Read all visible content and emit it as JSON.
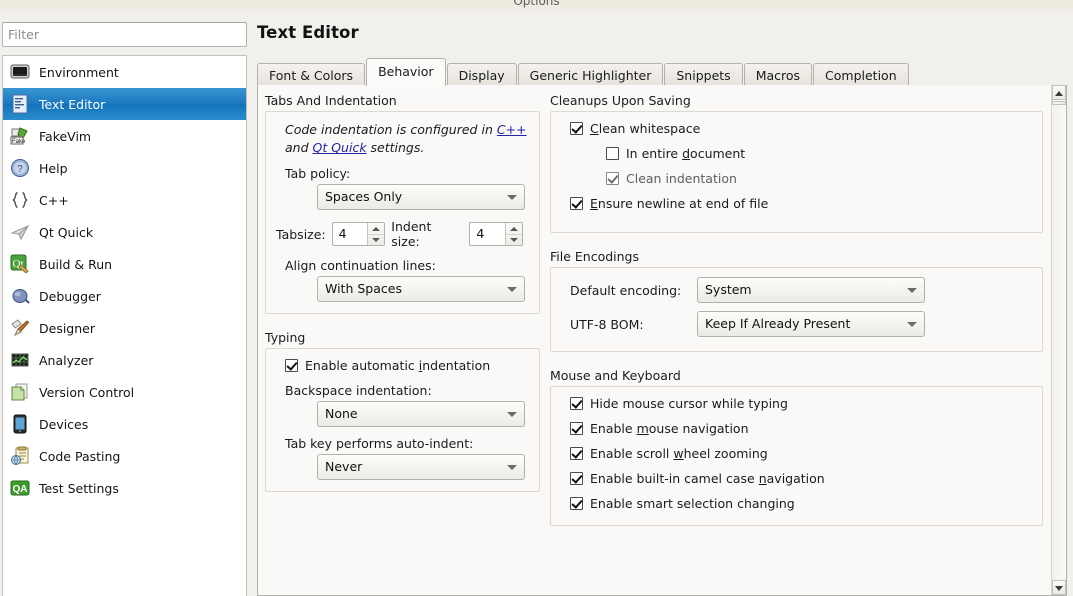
{
  "window": {
    "title": "Options"
  },
  "sidebar": {
    "filter": {
      "placeholder": "Filter",
      "value": ""
    },
    "items": [
      {
        "label": "Environment",
        "icon": "monitor-icon",
        "selected": false
      },
      {
        "label": "Text Editor",
        "icon": "text-editor-icon",
        "selected": true
      },
      {
        "label": "FakeVim",
        "icon": "fakevim-icon",
        "selected": false
      },
      {
        "label": "Help",
        "icon": "help-question-icon",
        "selected": false
      },
      {
        "label": "C++",
        "icon": "braces-icon",
        "selected": false
      },
      {
        "label": "Qt Quick",
        "icon": "paper-plane-icon",
        "selected": false
      },
      {
        "label": "Build & Run",
        "icon": "qt-build-icon",
        "selected": false
      },
      {
        "label": "Debugger",
        "icon": "bug-icon",
        "selected": false
      },
      {
        "label": "Designer",
        "icon": "brush-ruler-icon",
        "selected": false
      },
      {
        "label": "Analyzer",
        "icon": "grid-chart-icon",
        "selected": false
      },
      {
        "label": "Version Control",
        "icon": "documents-icon",
        "selected": false
      },
      {
        "label": "Devices",
        "icon": "tablet-icon",
        "selected": false
      },
      {
        "label": "Code Pasting",
        "icon": "clipboard-globe-icon",
        "selected": false
      },
      {
        "label": "Test Settings",
        "icon": "qa-badge-icon",
        "selected": false
      }
    ]
  },
  "page": {
    "title": "Text Editor",
    "tabs": [
      {
        "label": "Font & Colors",
        "active": false
      },
      {
        "label": "Behavior",
        "active": true
      },
      {
        "label": "Display",
        "active": false
      },
      {
        "label": "Generic Highlighter",
        "active": false
      },
      {
        "label": "Snippets",
        "active": false
      },
      {
        "label": "Macros",
        "active": false
      },
      {
        "label": "Completion",
        "active": false
      }
    ]
  },
  "tabs_and_indentation": {
    "title": "Tabs And Indentation",
    "hint": {
      "prefix": "Code indentation is configured in ",
      "link1": "C++",
      "middle": " and ",
      "link2": "Qt Quick",
      "suffix": " settings."
    },
    "tab_policy": {
      "label": "Tab policy:",
      "value": "Spaces Only"
    },
    "tab_size": {
      "label_pre": "Tab",
      "label_mn": "s",
      "label_post": "ize:",
      "value": "4"
    },
    "indent_size": {
      "label_pre": "",
      "label_mn": "I",
      "label_post": "ndent size:",
      "value": "4"
    },
    "align_continuation": {
      "label": "Align continuation lines:",
      "value": "With Spaces"
    }
  },
  "typing": {
    "title": "Typing",
    "enable_auto_indent": {
      "label_pre": "Enable automatic ",
      "label_mn": "i",
      "label_post": "ndentation",
      "checked": true
    },
    "backspace_indentation": {
      "label": "Backspace indentation:",
      "value": "None"
    },
    "tab_key_auto_indent": {
      "label": "Tab key performs auto-indent:",
      "value": "Never"
    }
  },
  "cleanups_upon_saving": {
    "title": "Cleanups Upon Saving",
    "items": [
      {
        "label_pre": "",
        "label_mn": "C",
        "label_post": "lean whitespace",
        "checked": true,
        "level": 1,
        "disabled": false
      },
      {
        "label_pre": "In entire ",
        "label_mn": "d",
        "label_post": "ocument",
        "checked": false,
        "level": 2,
        "disabled": false
      },
      {
        "label_pre": "Clean indentation",
        "label_mn": "",
        "label_post": "",
        "checked": true,
        "level": 2,
        "disabled": true
      },
      {
        "label_pre": "",
        "label_mn": "E",
        "label_post": "nsure newline at end of file",
        "checked": true,
        "level": 1,
        "disabled": false
      }
    ]
  },
  "file_encodings": {
    "title": "File Encodings",
    "default_encoding": {
      "label": "Default encoding:",
      "value": "System"
    },
    "utf8_bom": {
      "label": "UTF-8 BOM:",
      "value": "Keep If Already Present"
    }
  },
  "mouse_and_keyboard": {
    "title": "Mouse and Keyboard",
    "items": [
      {
        "label_pre": "Hide mouse cursor while typing",
        "label_mn": "",
        "label_post": "",
        "checked": true
      },
      {
        "label_pre": "Enable ",
        "label_mn": "m",
        "label_post": "ouse navigation",
        "checked": true
      },
      {
        "label_pre": "Enable scroll ",
        "label_mn": "w",
        "label_post": "heel zooming",
        "checked": true
      },
      {
        "label_pre": "Enable built-in camel case ",
        "label_mn": "n",
        "label_post": "avigation",
        "checked": true
      },
      {
        "label_pre": "Enable smart selection changing",
        "label_mn": "",
        "label_post": "",
        "checked": true
      }
    ]
  },
  "scrollbar": {
    "up_arrow": "scroll-up-arrow",
    "down_arrow": "scroll-down-arrow"
  },
  "colors": {
    "selection_blue": "#1a79bf",
    "window_bg": "#f1f0ec",
    "pane_bg": "#faf9f7",
    "link": "#2424a8",
    "group_border": "#dcd9d1"
  }
}
